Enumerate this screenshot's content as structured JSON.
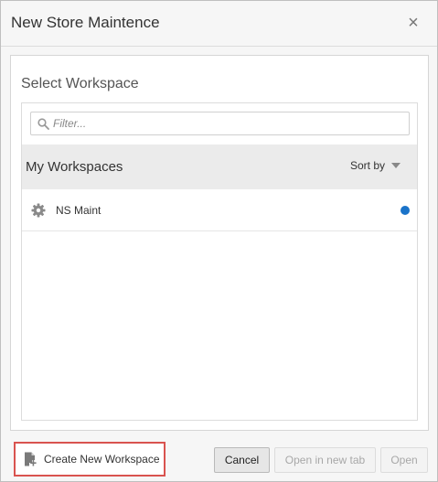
{
  "dialog": {
    "title": "New Store Maintence",
    "close_symbol": "×"
  },
  "workspace_picker": {
    "title": "Select Workspace",
    "filter_placeholder": "Filter...",
    "list_title": "My Workspaces",
    "sort_label": "Sort by",
    "items": [
      {
        "label": "NS Maint",
        "icon": "gear-icon",
        "status": "active",
        "status_color": "#1a73c9"
      }
    ]
  },
  "footer": {
    "create_label": "Create New Workspace",
    "cancel_label": "Cancel",
    "open_new_tab_label": "Open in new tab",
    "open_label": "Open"
  },
  "colors": {
    "highlight_border": "#d9534f",
    "active_dot": "#1a73c9"
  }
}
